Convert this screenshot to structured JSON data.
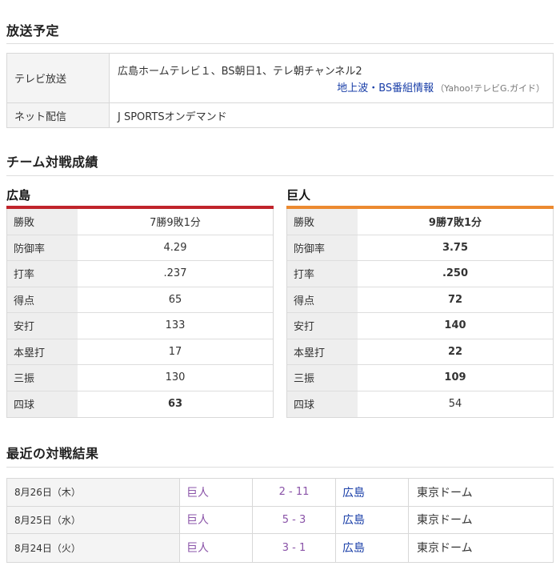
{
  "broadcast": {
    "title": "放送予定",
    "tv_label": "テレビ放送",
    "tv_channels": "広島ホームテレビ１、BS朝日1、テレ朝チャンネル2",
    "tv_link": "地上波・BS番組情報",
    "tv_link_sub": "（Yahoo!テレビG.ガイド）",
    "net_label": "ネット配信",
    "net_value": "J SPORTSオンデマンド"
  },
  "team_stats": {
    "title": "チーム対戦成績",
    "home": {
      "name": "広島",
      "color": "#c0242b",
      "rows": [
        {
          "label": "勝敗",
          "value": "7勝9敗1分",
          "bold": false
        },
        {
          "label": "防御率",
          "value": "4.29",
          "bold": false
        },
        {
          "label": "打率",
          "value": ".237",
          "bold": false
        },
        {
          "label": "得点",
          "value": "65",
          "bold": false
        },
        {
          "label": "安打",
          "value": "133",
          "bold": false
        },
        {
          "label": "本塁打",
          "value": "17",
          "bold": false
        },
        {
          "label": "三振",
          "value": "130",
          "bold": false
        },
        {
          "label": "四球",
          "value": "63",
          "bold": true
        }
      ]
    },
    "away": {
      "name": "巨人",
      "color": "#ec8a30",
      "rows": [
        {
          "label": "勝敗",
          "value": "9勝7敗1分",
          "bold": true
        },
        {
          "label": "防御率",
          "value": "3.75",
          "bold": true
        },
        {
          "label": "打率",
          "value": ".250",
          "bold": true
        },
        {
          "label": "得点",
          "value": "72",
          "bold": true
        },
        {
          "label": "安打",
          "value": "140",
          "bold": true
        },
        {
          "label": "本塁打",
          "value": "22",
          "bold": true
        },
        {
          "label": "三振",
          "value": "109",
          "bold": true
        },
        {
          "label": "四球",
          "value": "54",
          "bold": false
        }
      ]
    }
  },
  "recent": {
    "title": "最近の対戦結果",
    "games": [
      {
        "date": "8月26日（木）",
        "home": "巨人",
        "score": "2 - 11",
        "away": "広島",
        "venue": "東京ドーム"
      },
      {
        "date": "8月25日（水）",
        "home": "巨人",
        "score": "5 - 3",
        "away": "広島",
        "venue": "東京ドーム"
      },
      {
        "date": "8月24日（火）",
        "home": "巨人",
        "score": "3 - 1",
        "away": "広島",
        "venue": "東京ドーム"
      }
    ]
  }
}
